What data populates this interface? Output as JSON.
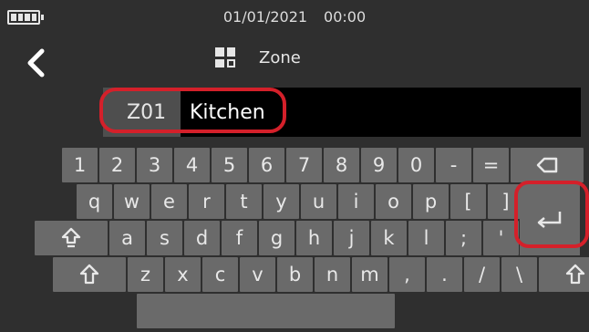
{
  "status": {
    "date": "01/01/2021",
    "time": "00:00",
    "battery_icon": "battery-full-icon"
  },
  "header": {
    "back_icon": "chevron-left-icon",
    "title_icon": "grid-icon",
    "title": "Zone"
  },
  "input": {
    "zone_id": "Z01",
    "value": "Kitchen"
  },
  "keyboard": {
    "row1": [
      "1",
      "2",
      "3",
      "4",
      "5",
      "6",
      "7",
      "8",
      "9",
      "0",
      "-",
      "="
    ],
    "row2": [
      "q",
      "w",
      "e",
      "r",
      "t",
      "y",
      "u",
      "i",
      "o",
      "p",
      "[",
      "]"
    ],
    "row3": [
      "a",
      "s",
      "d",
      "f",
      "g",
      "h",
      "j",
      "k",
      "l",
      ";",
      "'"
    ],
    "row4": [
      "z",
      "x",
      "c",
      "v",
      "b",
      "n",
      "m",
      ",",
      ".",
      "/",
      "\\"
    ],
    "icons": {
      "backspace": "backspace-icon",
      "enter": "enter-icon",
      "caps": "caps-lock-icon",
      "shift": "shift-icon"
    }
  },
  "colors": {
    "highlight": "#d4202a",
    "background": "#2f2f2f",
    "key": "#6a6a6a"
  }
}
